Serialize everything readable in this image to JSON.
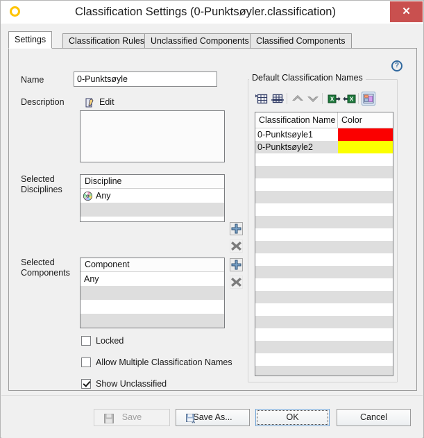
{
  "window": {
    "title": "Classification Settings (0-Punktsøyler.classification)",
    "app_icon": "ring-icon",
    "close_label": "✕"
  },
  "tabs": [
    {
      "label": "Settings",
      "active": true
    },
    {
      "label": "Classification Rules",
      "active": false
    },
    {
      "label": "Unclassified Components",
      "active": false
    },
    {
      "label": "Classified Components",
      "active": false
    }
  ],
  "help": {
    "glyph": "?"
  },
  "form": {
    "name_label": "Name",
    "name_value": "0-Punktsøyle",
    "name_placeholder": "",
    "description_label": "Description",
    "description_edit_label": "Edit",
    "description_value": "",
    "selected_disciplines_label": "Selected\nDisciplines",
    "selected_components_label": "Selected\nComponents",
    "disciplines": {
      "header": "Discipline",
      "rows": [
        "Any",
        "",
        "",
        ""
      ]
    },
    "components": {
      "header": "Component",
      "rows": [
        "Any",
        "",
        "",
        ""
      ]
    },
    "add_button_title": "Add",
    "remove_button_title": "Remove",
    "checkboxes": [
      {
        "label": "Locked",
        "checked": false
      },
      {
        "label": "Allow Multiple Classification Names",
        "checked": false
      },
      {
        "label": "Show Unclassified",
        "checked": true
      }
    ]
  },
  "group": {
    "title": "Default Classification Names",
    "toolbar": [
      {
        "name": "insert-row-icon"
      },
      {
        "name": "delete-row-icon"
      },
      {
        "name": "move-up-icon"
      },
      {
        "name": "move-down-icon"
      },
      {
        "name": "export-excel-icon"
      },
      {
        "name": "import-excel-icon"
      },
      {
        "name": "color-palette-icon"
      }
    ],
    "table": {
      "columns": [
        "Classification Name",
        "Color"
      ],
      "rows": [
        {
          "name": "0-Punktsøyle1",
          "color": "#fb0000"
        },
        {
          "name": "0-Punktsøyle2",
          "color": "#fbff00"
        }
      ],
      "empty_row_count": 18
    }
  },
  "buttons": {
    "save": "Save",
    "save_as": "Save As...",
    "ok": "OK",
    "cancel": "Cancel"
  },
  "colors": {
    "accent": "#31699e",
    "close_red": "#c9504f",
    "app_icon": "#ffc400",
    "row_alt": "#dedede"
  }
}
